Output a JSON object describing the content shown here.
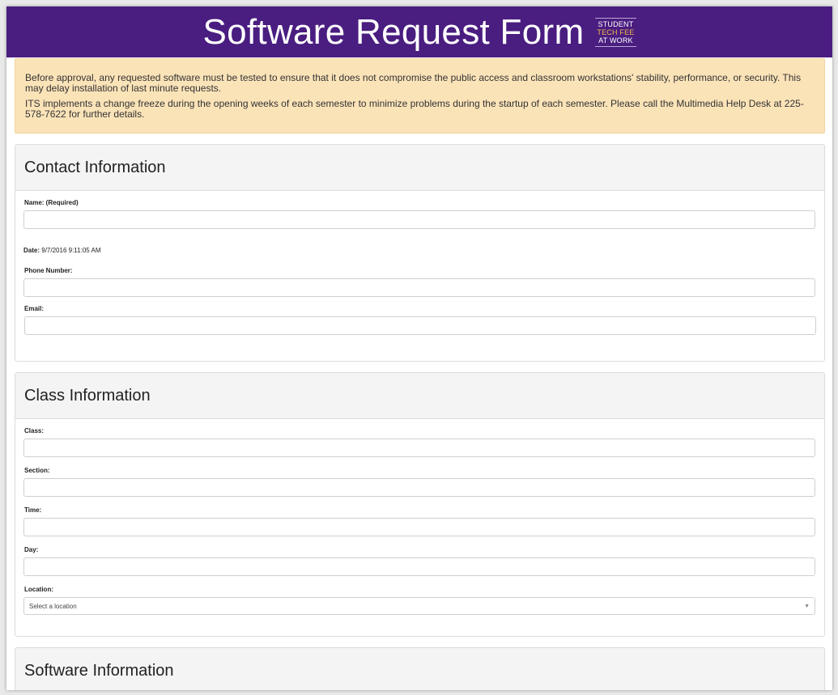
{
  "header": {
    "title": "Software Request Form",
    "logo": {
      "line1": "STUDENT",
      "line2": "TECH FEE",
      "line3": "AT WORK",
      "accent": "#f0b84a"
    },
    "bg": "#4a1d80"
  },
  "notice": {
    "p1": "Before approval, any requested software must be tested to ensure that it does not compromise the public access and classroom workstations' stability, performance, or security. This may delay installation of last minute requests.",
    "p2": "ITS implements a change freeze during the opening weeks of each semester to minimize problems during the startup of each semester. Please call the Multimedia Help Desk at 225-578-7622 for further details."
  },
  "contact": {
    "heading": "Contact Information",
    "name_label": "Name: (Required)",
    "name_value": "",
    "date_label": "Date:",
    "date_value": "9/7/2016 9:11:05 AM",
    "phone_label": "Phone Number:",
    "phone_value": "",
    "email_label": "Email:",
    "email_value": ""
  },
  "class": {
    "heading": "Class Information",
    "class_label": "Class:",
    "section_label": "Section:",
    "time_label": "Time:",
    "day_label": "Day:",
    "location_label": "Location:",
    "location_selected": "Select a location"
  },
  "software": {
    "heading": "Software Information"
  }
}
